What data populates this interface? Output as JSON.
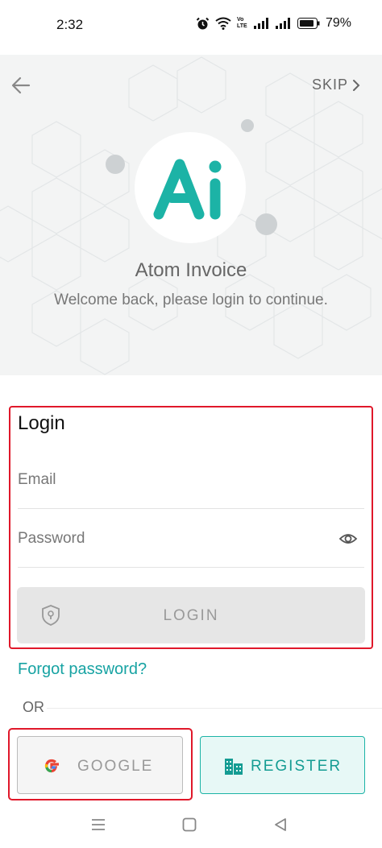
{
  "status_bar": {
    "time": "2:32",
    "battery_percent": "79%",
    "network_label": "Vo LTE"
  },
  "header": {
    "skip_label": "SKIP"
  },
  "brand": {
    "logo_text": "Ai",
    "app_name": "Atom Invoice",
    "welcome_message": "Welcome back, please login to continue.",
    "accent_color": "#1cb3a6"
  },
  "login_form": {
    "title": "Login",
    "email_placeholder": "Email",
    "email_value": "",
    "password_placeholder": "Password",
    "password_value": "",
    "login_button_label": "LOGIN",
    "forgot_password_label": "Forgot password?"
  },
  "divider": {
    "or_label": "OR"
  },
  "social": {
    "google_label": "GOOGLE",
    "register_label": "REGISTER"
  },
  "highlight_color": "#e0182a",
  "icons": [
    "back-arrow-icon",
    "chevron-right-icon",
    "eye-icon",
    "shield-lock-icon",
    "google-icon",
    "building-icon",
    "menu-icon",
    "home-square-icon",
    "back-triangle-icon"
  ]
}
